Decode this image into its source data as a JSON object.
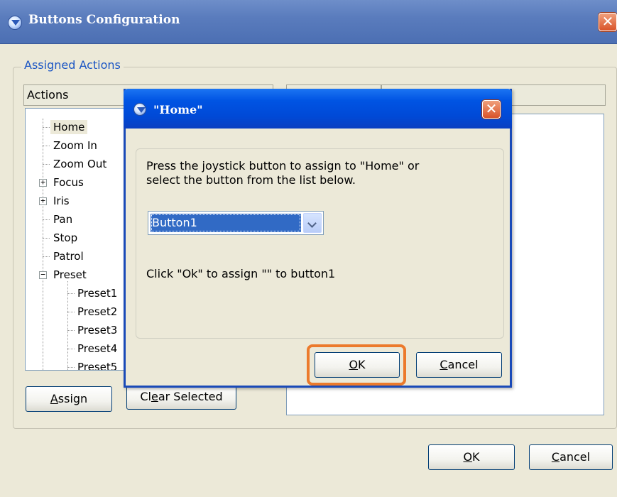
{
  "main_window": {
    "title": "Buttons Configuration",
    "group_label": "Assigned Actions",
    "actions_header": "Actions",
    "tree": [
      {
        "label": "Home",
        "level": 0,
        "expander": "",
        "selected": true
      },
      {
        "label": "Zoom In",
        "level": 0,
        "expander": ""
      },
      {
        "label": "Zoom Out",
        "level": 0,
        "expander": ""
      },
      {
        "label": "Focus",
        "level": 0,
        "expander": "+"
      },
      {
        "label": "Iris",
        "level": 0,
        "expander": "+"
      },
      {
        "label": "Pan",
        "level": 0,
        "expander": ""
      },
      {
        "label": "Stop",
        "level": 0,
        "expander": ""
      },
      {
        "label": "Patrol",
        "level": 0,
        "expander": ""
      },
      {
        "label": "Preset",
        "level": 0,
        "expander": "−"
      },
      {
        "label": "Preset1",
        "level": 1
      },
      {
        "label": "Preset2",
        "level": 1
      },
      {
        "label": "Preset3",
        "level": 1
      },
      {
        "label": "Preset4",
        "level": 1
      },
      {
        "label": "Preset5",
        "level": 1
      }
    ],
    "assign_button": {
      "pre": "",
      "key": "A",
      "post": "ssign"
    },
    "clear_button": {
      "pre": "Cl",
      "key": "e",
      "post": "ar Selected"
    },
    "ok_button": {
      "pre": "",
      "key": "O",
      "post": "K"
    },
    "cancel_button": {
      "pre": "",
      "key": "C",
      "post": "ancel"
    }
  },
  "dialog": {
    "title": "\"Home\"",
    "prompt_line1": "Press the joystick button to assign to \"Home\" or",
    "prompt_line2": "select the button from the list below.",
    "selected_button": "Button1",
    "confirm_text": "Click \"Ok\" to assign \"\" to button1",
    "ok_button": {
      "pre": "",
      "key": "O",
      "post": "K"
    },
    "cancel_button": {
      "pre": "",
      "key": "C",
      "post": "ancel"
    }
  },
  "colors": {
    "highlight_ring": "#ec7a2c",
    "dialog_titlebar": "#0054e3",
    "main_titlebar": "#5a7cbd",
    "legend_text": "#1a55c4"
  }
}
